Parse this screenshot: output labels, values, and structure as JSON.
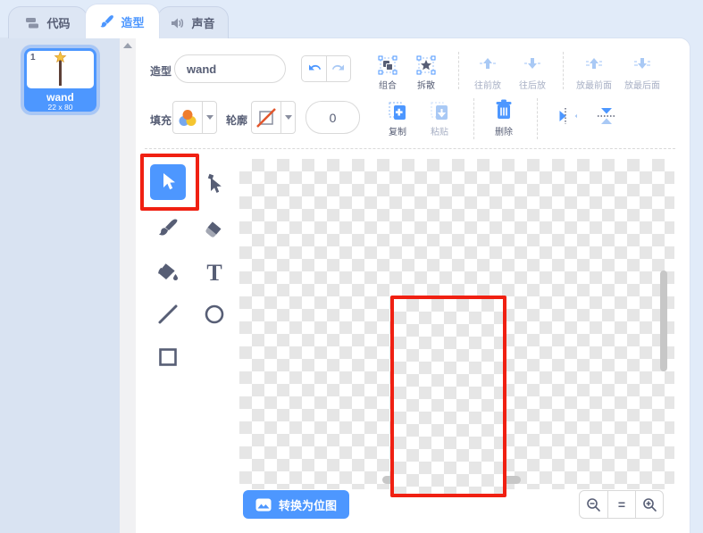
{
  "tabs": {
    "code": "代码",
    "costumes": "造型",
    "sounds": "声音"
  },
  "costume_panel": {
    "index": "1",
    "name": "wand",
    "size": "22 x 80"
  },
  "toolbar": {
    "costume_label": "造型",
    "costume_name_value": "wand",
    "group_label": "组合",
    "ungroup_label": "拆散",
    "forward_label": "往前放",
    "backward_label": "往后放",
    "front_label": "放最前面",
    "back_label": "放最后面",
    "fill_label": "填充",
    "outline_label": "轮廓",
    "stroke_width_value": "0",
    "copy_label": "复制",
    "paste_label": "粘贴",
    "delete_label": "删除"
  },
  "canvas": {
    "convert_button_label": "转换为位图",
    "zoom_reset_label": "="
  },
  "colors": {
    "accent_blue": "#4d97ff",
    "selection_blue": "#1e9ee8",
    "annotation_red": "#f02012",
    "star_gold": "#f3c84e",
    "star_gold_dark": "#d9992b",
    "disabled_blue": "#a9c9f5",
    "icon_dark": "#575e75"
  }
}
